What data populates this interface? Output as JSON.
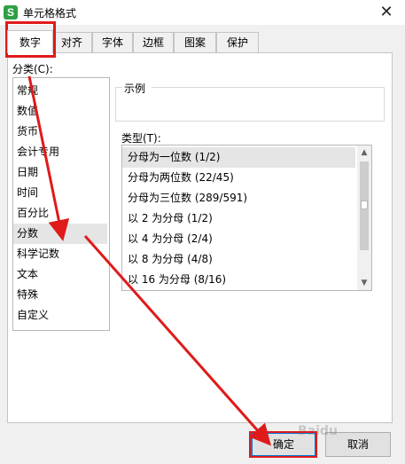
{
  "window": {
    "title": "单元格格式",
    "app_icon_glyph": "S",
    "app_icon_color": "#2ea043",
    "close_glyph": "✕"
  },
  "tabs": [
    {
      "label": "数字",
      "active": true
    },
    {
      "label": "对齐",
      "active": false
    },
    {
      "label": "字体",
      "active": false
    },
    {
      "label": "边框",
      "active": false
    },
    {
      "label": "图案",
      "active": false
    },
    {
      "label": "保护",
      "active": false
    }
  ],
  "category": {
    "label": "分类(C):",
    "items": [
      "常规",
      "数值",
      "货币",
      "会计专用",
      "日期",
      "时间",
      "百分比",
      "分数",
      "科学记数",
      "文本",
      "特殊",
      "自定义"
    ],
    "selected_index": 7
  },
  "sample": {
    "label": "示例"
  },
  "type": {
    "label": "类型(T):",
    "items": [
      "分母为一位数 (1/2)",
      "分母为两位数 (22/45)",
      "分母为三位数 (289/591)",
      "以 2 为分母 (1/2)",
      "以 4 为分母 (2/4)",
      "以 8 为分母 (4/8)",
      "以 16 为分母 (8/16)"
    ],
    "selected_index": 0,
    "scroll_up_glyph": "▲",
    "scroll_down_glyph": "▼"
  },
  "buttons": {
    "ok": "确定",
    "cancel": "取消"
  },
  "watermark": "Baidu",
  "colors": {
    "annotation_red": "#e01a1a",
    "ok_border": "#0078d7"
  }
}
